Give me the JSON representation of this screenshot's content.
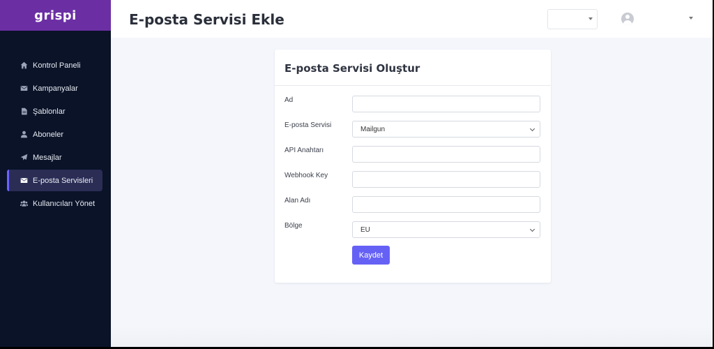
{
  "brand": {
    "name": "grispi"
  },
  "sidebar": {
    "items": [
      {
        "label": "Kontrol Paneli",
        "icon": "home-icon"
      },
      {
        "label": "Kampanyalar",
        "icon": "envelope-icon"
      },
      {
        "label": "Şablonlar",
        "icon": "file-icon"
      },
      {
        "label": "Aboneler",
        "icon": "user-icon"
      },
      {
        "label": "Mesajlar",
        "icon": "paper-plane-icon"
      },
      {
        "label": "E-posta Servisleri",
        "icon": "envelope-icon",
        "active": true
      },
      {
        "label": "Kullanıcıları Yönet",
        "icon": "users-icon"
      }
    ]
  },
  "header": {
    "title": "E-posta Servisi Ekle"
  },
  "form": {
    "title": "E-posta Servisi Oluştur",
    "fields": {
      "name": {
        "label": "Ad",
        "value": ""
      },
      "service": {
        "label": "E-posta Servisi",
        "value": "Mailgun"
      },
      "api_key": {
        "label": "API Anahtarı",
        "value": ""
      },
      "webhook_key": {
        "label": "Webhook Key",
        "value": ""
      },
      "domain": {
        "label": "Alan Adı",
        "value": ""
      },
      "region": {
        "label": "Bölge",
        "value": "EU"
      }
    },
    "save_label": "Kaydet"
  },
  "colors": {
    "brand": "#6b2fa3",
    "sidebar_bg": "#0a1328",
    "primary_button": "#6661f5"
  }
}
